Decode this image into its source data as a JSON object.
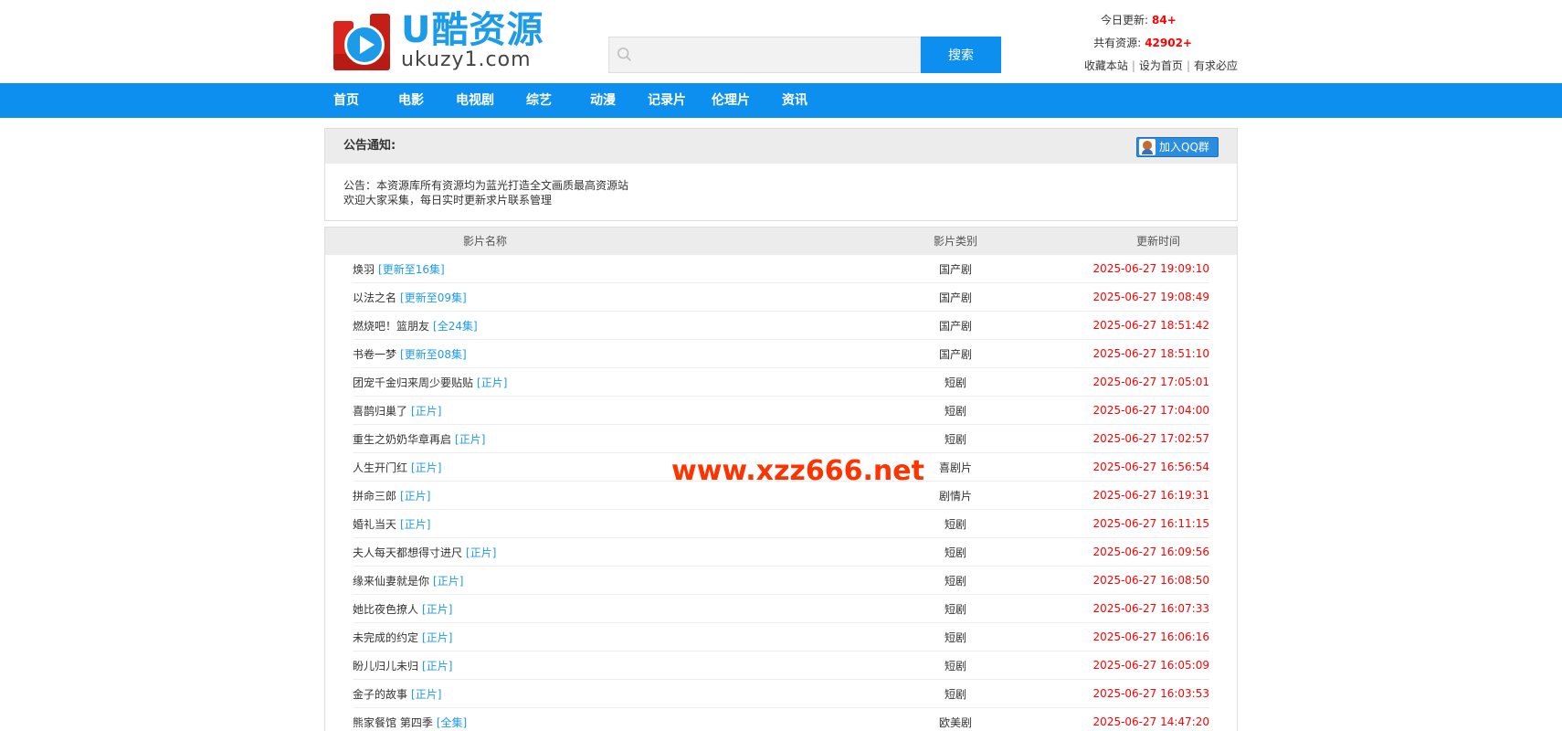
{
  "header": {
    "logo_cn": "U酷资源",
    "logo_en": "ukuzy1.com",
    "search_placeholder": "",
    "search_button": "搜索",
    "stats": {
      "today_label": "今日更新:",
      "today_value": "84+",
      "total_label": "共有资源:",
      "total_value": "42902+"
    },
    "links": [
      "收藏本站",
      "设为首页",
      "有求必应"
    ]
  },
  "nav": [
    "首页",
    "电影",
    "电视剧",
    "综艺",
    "动漫",
    "记录片",
    "伦理片",
    "资讯"
  ],
  "notice": {
    "title": "公告通知:",
    "qq_button": "加入QQ群",
    "line1": "公告：本资源库所有资源均为蓝光打造全文画质最高资源站",
    "line2": "欢迎大家采集，每日实时更新求片联系管理"
  },
  "table": {
    "headers": {
      "name": "影片名称",
      "type": "影片类别",
      "time": "更新时间"
    },
    "rows": [
      {
        "name": "焕羽",
        "tag": "[更新至16集]",
        "type": "国产剧",
        "time": "2025-06-27 19:09:10"
      },
      {
        "name": "以法之名",
        "tag": "[更新至09集]",
        "type": "国产剧",
        "time": "2025-06-27 19:08:49"
      },
      {
        "name": "燃烧吧！篮朋友",
        "tag": "[全24集]",
        "type": "国产剧",
        "time": "2025-06-27 18:51:42"
      },
      {
        "name": "书卷一梦",
        "tag": "[更新至08集]",
        "type": "国产剧",
        "time": "2025-06-27 18:51:10"
      },
      {
        "name": "团宠千金归来周少要贴贴",
        "tag": "[正片]",
        "type": "短剧",
        "time": "2025-06-27 17:05:01"
      },
      {
        "name": "喜鹊归巢了",
        "tag": "[正片]",
        "type": "短剧",
        "time": "2025-06-27 17:04:00"
      },
      {
        "name": "重生之奶奶华章再启",
        "tag": "[正片]",
        "type": "短剧",
        "time": "2025-06-27 17:02:57"
      },
      {
        "name": "人生开门红",
        "tag": "[正片]",
        "type": "喜剧片",
        "time": "2025-06-27 16:56:54"
      },
      {
        "name": "拼命三郎",
        "tag": "[正片]",
        "type": "剧情片",
        "time": "2025-06-27 16:19:31"
      },
      {
        "name": "婚礼当天",
        "tag": "[正片]",
        "type": "短剧",
        "time": "2025-06-27 16:11:15"
      },
      {
        "name": "夫人每天都想得寸进尺",
        "tag": "[正片]",
        "type": "短剧",
        "time": "2025-06-27 16:09:56"
      },
      {
        "name": "缘来仙妻就是你",
        "tag": "[正片]",
        "type": "短剧",
        "time": "2025-06-27 16:08:50"
      },
      {
        "name": "她比夜色撩人",
        "tag": "[正片]",
        "type": "短剧",
        "time": "2025-06-27 16:07:33"
      },
      {
        "name": "未完成的约定",
        "tag": "[正片]",
        "type": "短剧",
        "time": "2025-06-27 16:06:16"
      },
      {
        "name": "盼儿归儿未归",
        "tag": "[正片]",
        "type": "短剧",
        "time": "2025-06-27 16:05:09"
      },
      {
        "name": "金子的故事",
        "tag": "[正片]",
        "type": "短剧",
        "time": "2025-06-27 16:03:53"
      },
      {
        "name": "熊家餐馆 第四季",
        "tag": "[全集]",
        "type": "欧美剧",
        "time": "2025-06-27 14:47:20"
      }
    ]
  },
  "watermark": "www.xzz666.net",
  "colors": {
    "primary": "#0d8ff0",
    "accent_red": "#ff0000",
    "tag_blue": "#1e9be8"
  }
}
